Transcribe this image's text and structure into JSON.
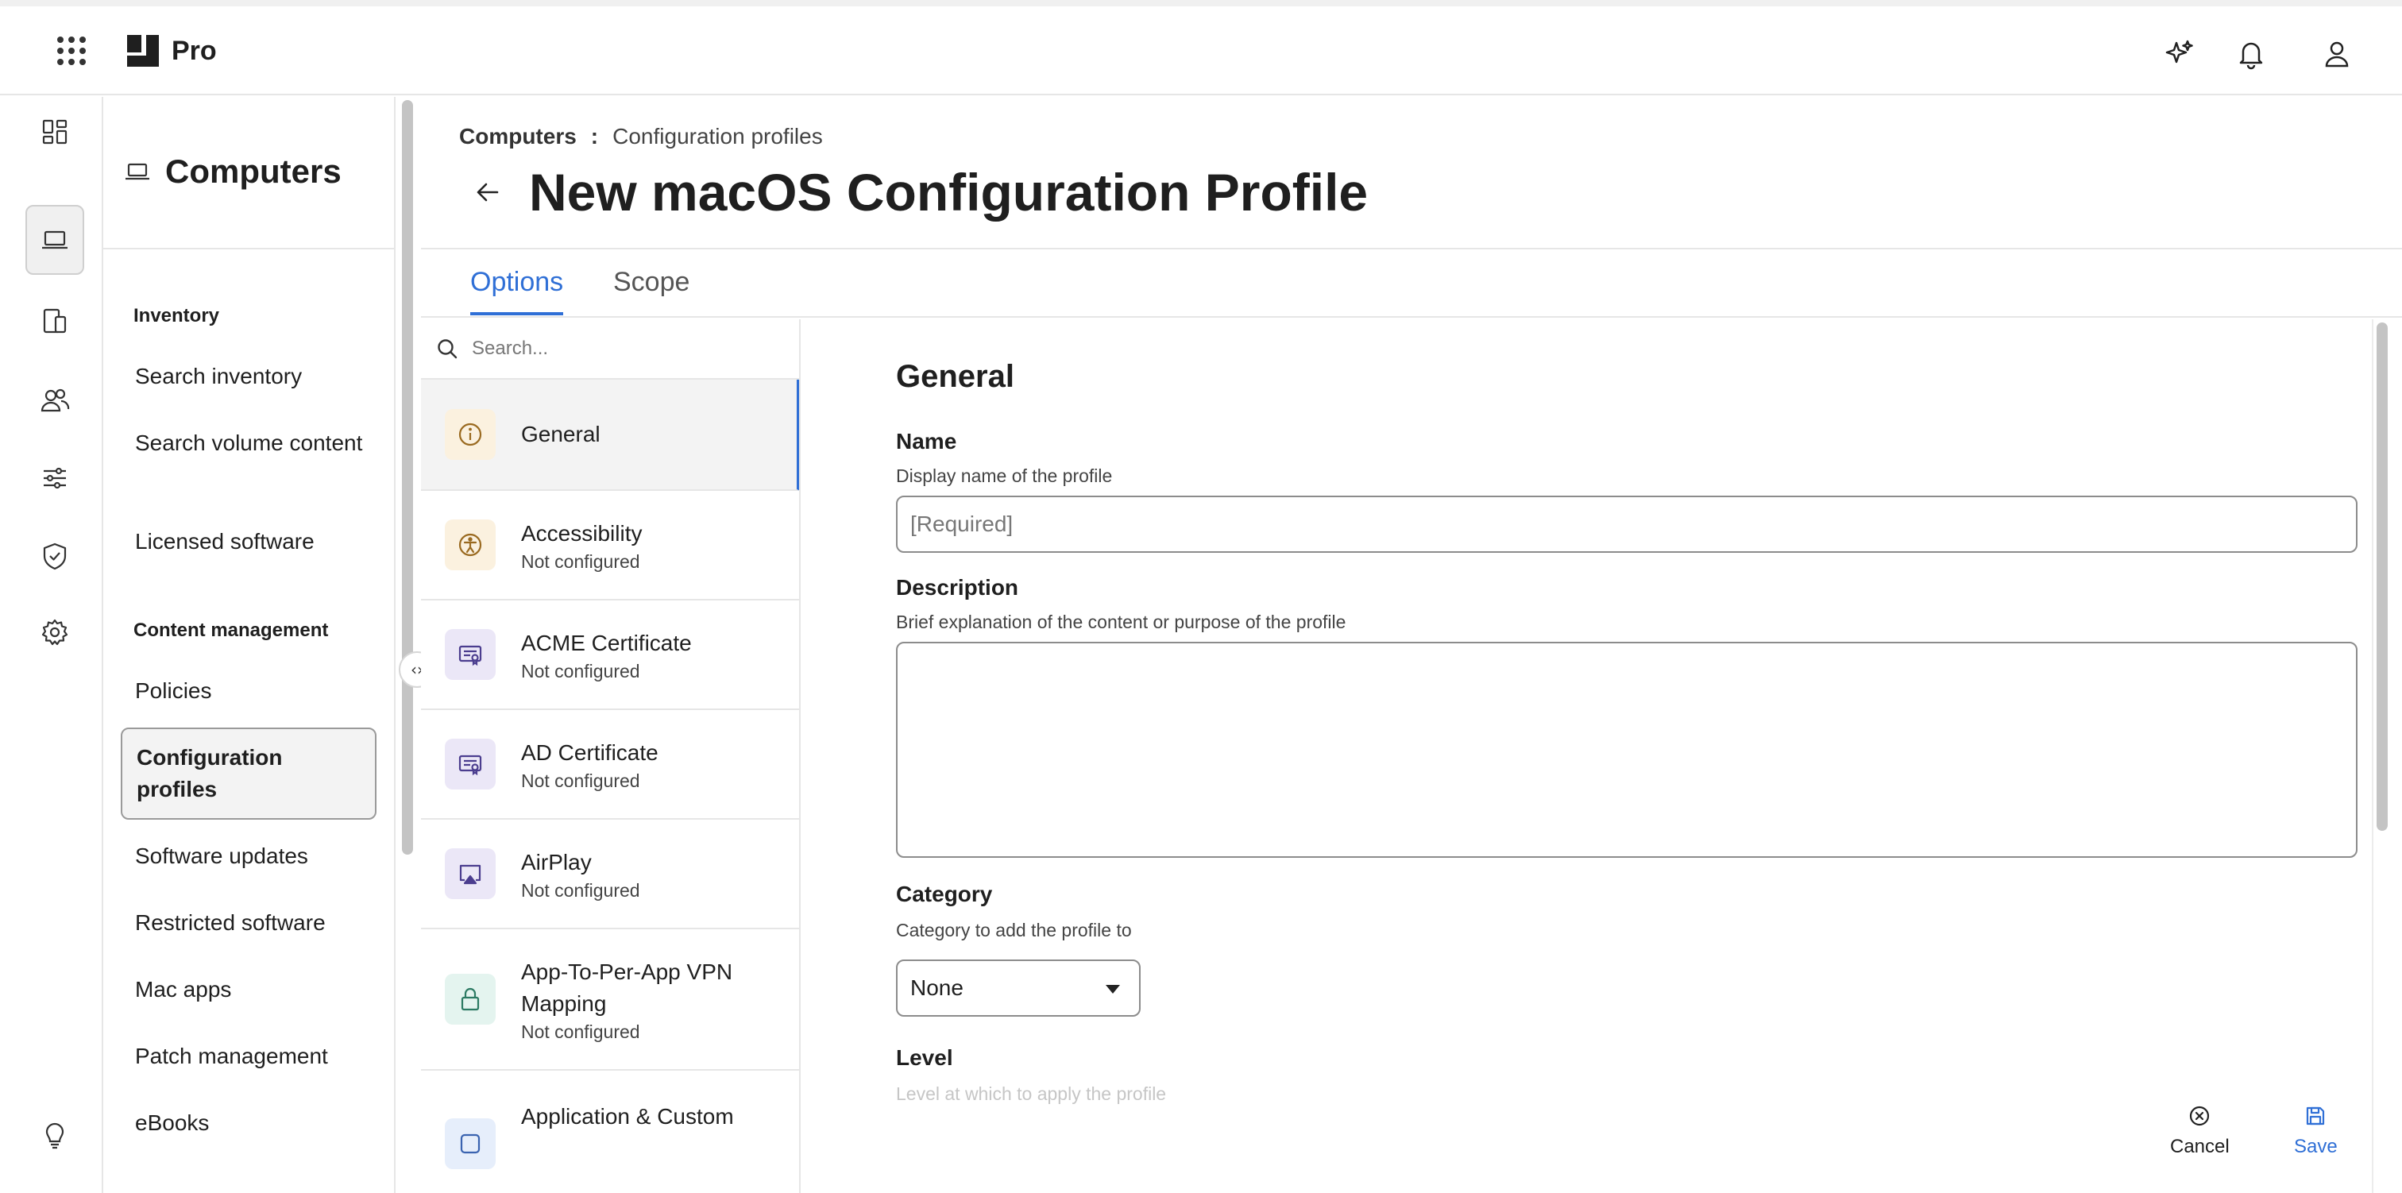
{
  "topbar": {
    "brand_name": "Pro",
    "icons": [
      "app-launcher-icon",
      "ai-sparkle-icon",
      "bell-icon",
      "user-icon"
    ]
  },
  "rail": {
    "items": [
      {
        "icon": "dashboard-icon",
        "active": false
      },
      {
        "icon": "laptop-icon",
        "active": true
      },
      {
        "icon": "mobile-devices-icon",
        "active": false
      },
      {
        "icon": "users-icon",
        "active": false
      },
      {
        "icon": "sliders-icon",
        "active": false
      },
      {
        "icon": "shield-check-icon",
        "active": false
      },
      {
        "icon": "gear-icon",
        "active": false
      },
      {
        "icon": "lightbulb-icon",
        "active": false
      }
    ]
  },
  "nav": {
    "title": "Computers",
    "sections": [
      {
        "label": "Inventory",
        "items": [
          "Search inventory",
          "Search volume content",
          "Licensed software"
        ]
      },
      {
        "label": "Content management",
        "items": [
          "Policies",
          "Configuration profiles",
          "Software updates",
          "Restricted software",
          "Mac apps",
          "Patch management",
          "eBooks"
        ]
      }
    ],
    "active_item": "Configuration profiles"
  },
  "breadcrumb": {
    "parent": "Computers",
    "separator": ":",
    "current": "Configuration profiles"
  },
  "page": {
    "title": "New macOS Configuration Profile"
  },
  "tabs": [
    {
      "label": "Options",
      "active": true
    },
    {
      "label": "Scope",
      "active": false
    }
  ],
  "payloads": {
    "search_placeholder": "Search...",
    "items": [
      {
        "name": "General",
        "status": "",
        "icon": "info-icon",
        "icon_bg": "#fbf1df",
        "icon_color": "#9a6a20",
        "active": true
      },
      {
        "name": "Accessibility",
        "status": "Not configured",
        "icon": "accessibility-icon",
        "icon_bg": "#fbf1df",
        "icon_color": "#9a6a20",
        "active": false
      },
      {
        "name": "ACME Certificate",
        "status": "Not configured",
        "icon": "certificate-icon",
        "icon_bg": "#ebe7f7",
        "icon_color": "#4b3d8f",
        "active": false
      },
      {
        "name": "AD Certificate",
        "status": "Not configured",
        "icon": "certificate-icon",
        "icon_bg": "#ebe7f7",
        "icon_color": "#4b3d8f",
        "active": false
      },
      {
        "name": "AirPlay",
        "status": "Not configured",
        "icon": "airplay-icon",
        "icon_bg": "#ebe7f7",
        "icon_color": "#4b3d8f",
        "active": false
      },
      {
        "name": "App-To-Per-App VPN Mapping",
        "status": "Not configured",
        "icon": "lock-icon",
        "icon_bg": "#e4f4ef",
        "icon_color": "#2c7a63",
        "active": false
      },
      {
        "name": "Application & Custom",
        "status": "",
        "icon": "app-icon",
        "icon_bg": "#e6eefb",
        "icon_color": "#3a63b0",
        "active": false
      }
    ]
  },
  "form": {
    "section_title": "General",
    "name": {
      "label": "Name",
      "help": "Display name of the profile",
      "placeholder": "[Required]",
      "value": ""
    },
    "description": {
      "label": "Description",
      "help": "Brief explanation of the content or purpose of the profile",
      "value": ""
    },
    "category": {
      "label": "Category",
      "help": "Category to add the profile to",
      "selected": "None"
    },
    "level": {
      "label": "Level",
      "help": "Level at which to apply the profile"
    }
  },
  "actions": {
    "cancel": "Cancel",
    "save": "Save"
  },
  "colors": {
    "accent": "#2f6fd6",
    "border": "#e6e6e6"
  }
}
